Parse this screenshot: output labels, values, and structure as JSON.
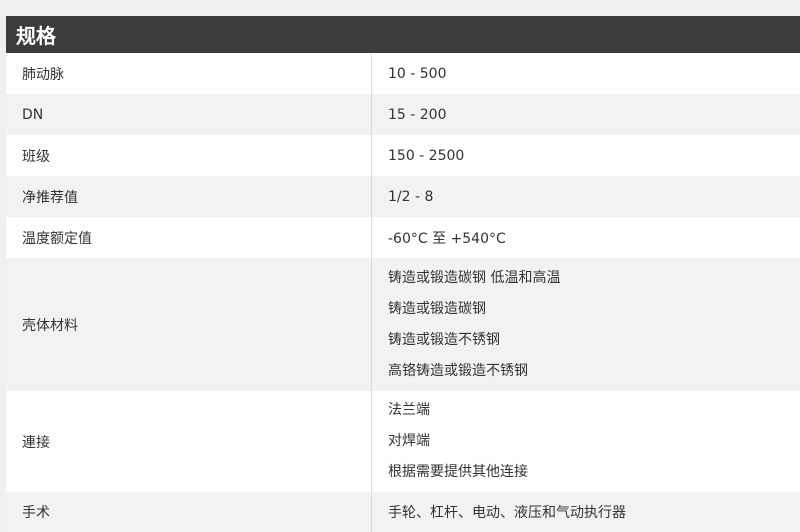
{
  "header": {
    "title": "规格"
  },
  "rows": [
    {
      "label": "肺动脉",
      "values": [
        "10 - 500"
      ]
    },
    {
      "label": "DN",
      "values": [
        "15 - 200"
      ]
    },
    {
      "label": "班级",
      "values": [
        "150 - 2500"
      ]
    },
    {
      "label": "净推荐值",
      "values": [
        "1/2 - 8"
      ]
    },
    {
      "label": "温度额定值",
      "values": [
        "-60°C 至 +540°C"
      ]
    },
    {
      "label": "壳体材料",
      "values": [
        "铸造或锻造碳钢 低温和高温",
        "铸造或锻造碳钢",
        "铸造或锻造不锈钢",
        "高铬铸造或锻造不锈钢"
      ]
    },
    {
      "label": "連接",
      "values": [
        "法兰端",
        "对焊端",
        "根据需要提供其他连接"
      ]
    },
    {
      "label": "手术",
      "values": [
        "手轮、杠杆、电动、液压和气动执行器"
      ]
    }
  ]
}
